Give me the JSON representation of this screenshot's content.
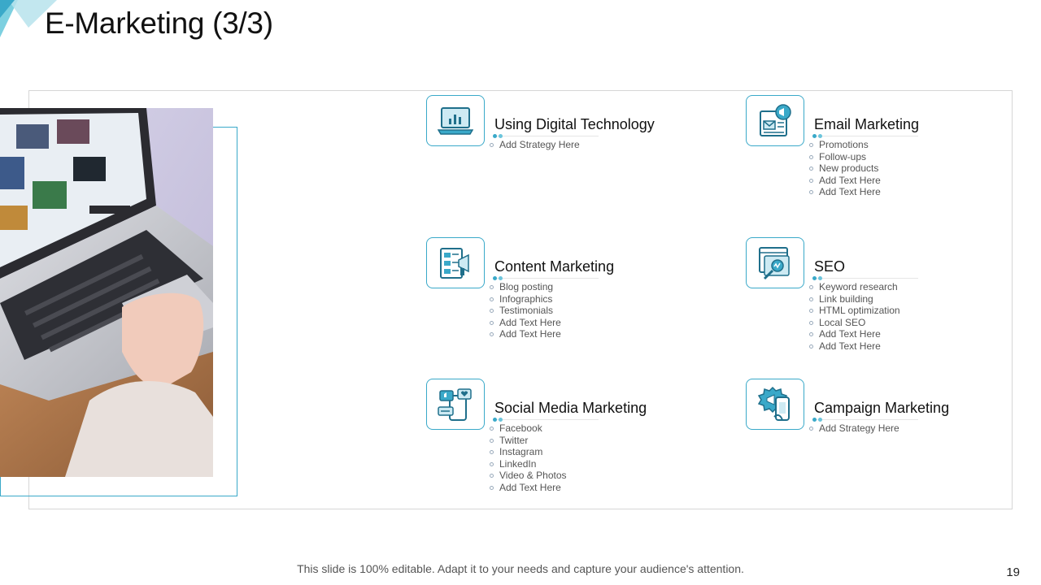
{
  "slide": {
    "title": "E-Marketing (3/3)",
    "footer": "This slide is 100% editable. Adapt it to your needs and capture your audience's attention.",
    "page_number": "19",
    "accent_color": "#3aa9c9"
  },
  "items": [
    {
      "title": "Using Digital Technology",
      "icon": "laptop-chart-icon",
      "bullets": [
        "Add Strategy Here"
      ]
    },
    {
      "title": "Email Marketing",
      "icon": "email-megaphone-icon",
      "bullets": [
        "Promotions",
        "Follow-ups",
        "New products",
        "Add Text Here",
        "Add Text Here"
      ]
    },
    {
      "title": "Content Marketing",
      "icon": "content-megaphone-icon",
      "bullets": [
        "Blog posting",
        "Infographics",
        "Testimonials",
        "Add Text Here",
        "Add Text Here"
      ]
    },
    {
      "title": "SEO",
      "icon": "seo-search-icon",
      "bullets": [
        "Keyword research",
        "Link building",
        "HTML optimization",
        "Local SEO",
        "Add Text Here",
        "Add Text Here"
      ]
    },
    {
      "title": "Social Media Marketing",
      "icon": "social-media-icon",
      "bullets": [
        "Facebook",
        "Twitter",
        "Instagram",
        "LinkedIn",
        "Video & Photos",
        "Add Text Here"
      ]
    },
    {
      "title": "Campaign Marketing",
      "icon": "campaign-badge-icon",
      "bullets": [
        "Add Strategy Here"
      ]
    }
  ]
}
